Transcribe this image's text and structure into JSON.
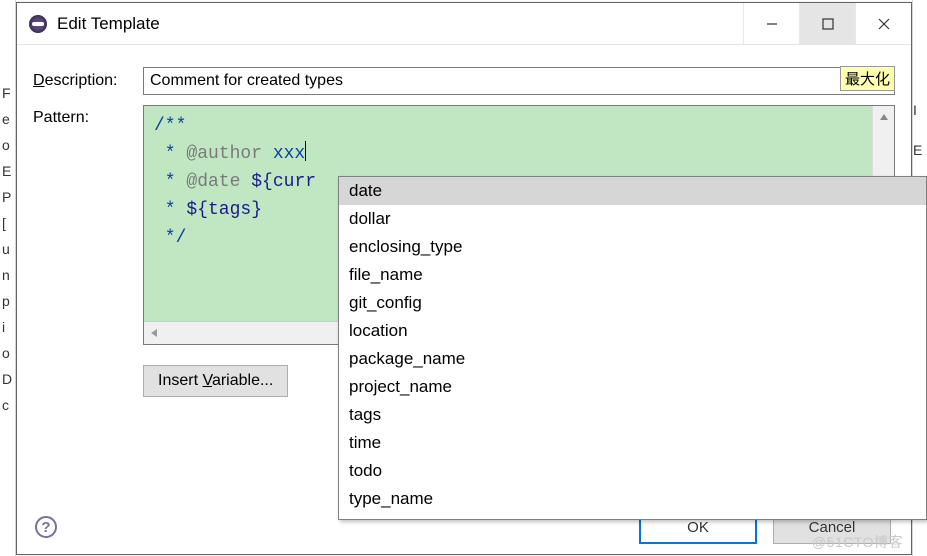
{
  "window": {
    "title": "Edit Template",
    "max_badge": "最大化"
  },
  "form": {
    "description_label_pre": "D",
    "description_label_post": "escription:",
    "description_value": "Comment for created types",
    "pattern_label_pre": "P",
    "pattern_label_post": "attern:",
    "insert_variable_label": "Insert Variable..."
  },
  "code": {
    "l1": "/**",
    "l2a": " * ",
    "l2tag": "@author",
    "l2b": " xxx",
    "l3a": " * ",
    "l3tag": "@date",
    "l3b": " ",
    "l3var": "${curr",
    "l4a": " * ",
    "l4var": "${tags}",
    "l5": " */"
  },
  "popup": {
    "items": [
      "date",
      "dollar",
      "enclosing_type",
      "file_name",
      "git_config",
      "location",
      "package_name",
      "project_name",
      "tags",
      "time",
      "todo",
      "type_name"
    ],
    "selected_index": 0
  },
  "footer": {
    "ok": "OK",
    "cancel": "Cancel"
  },
  "watermark": "@51CTO博客"
}
